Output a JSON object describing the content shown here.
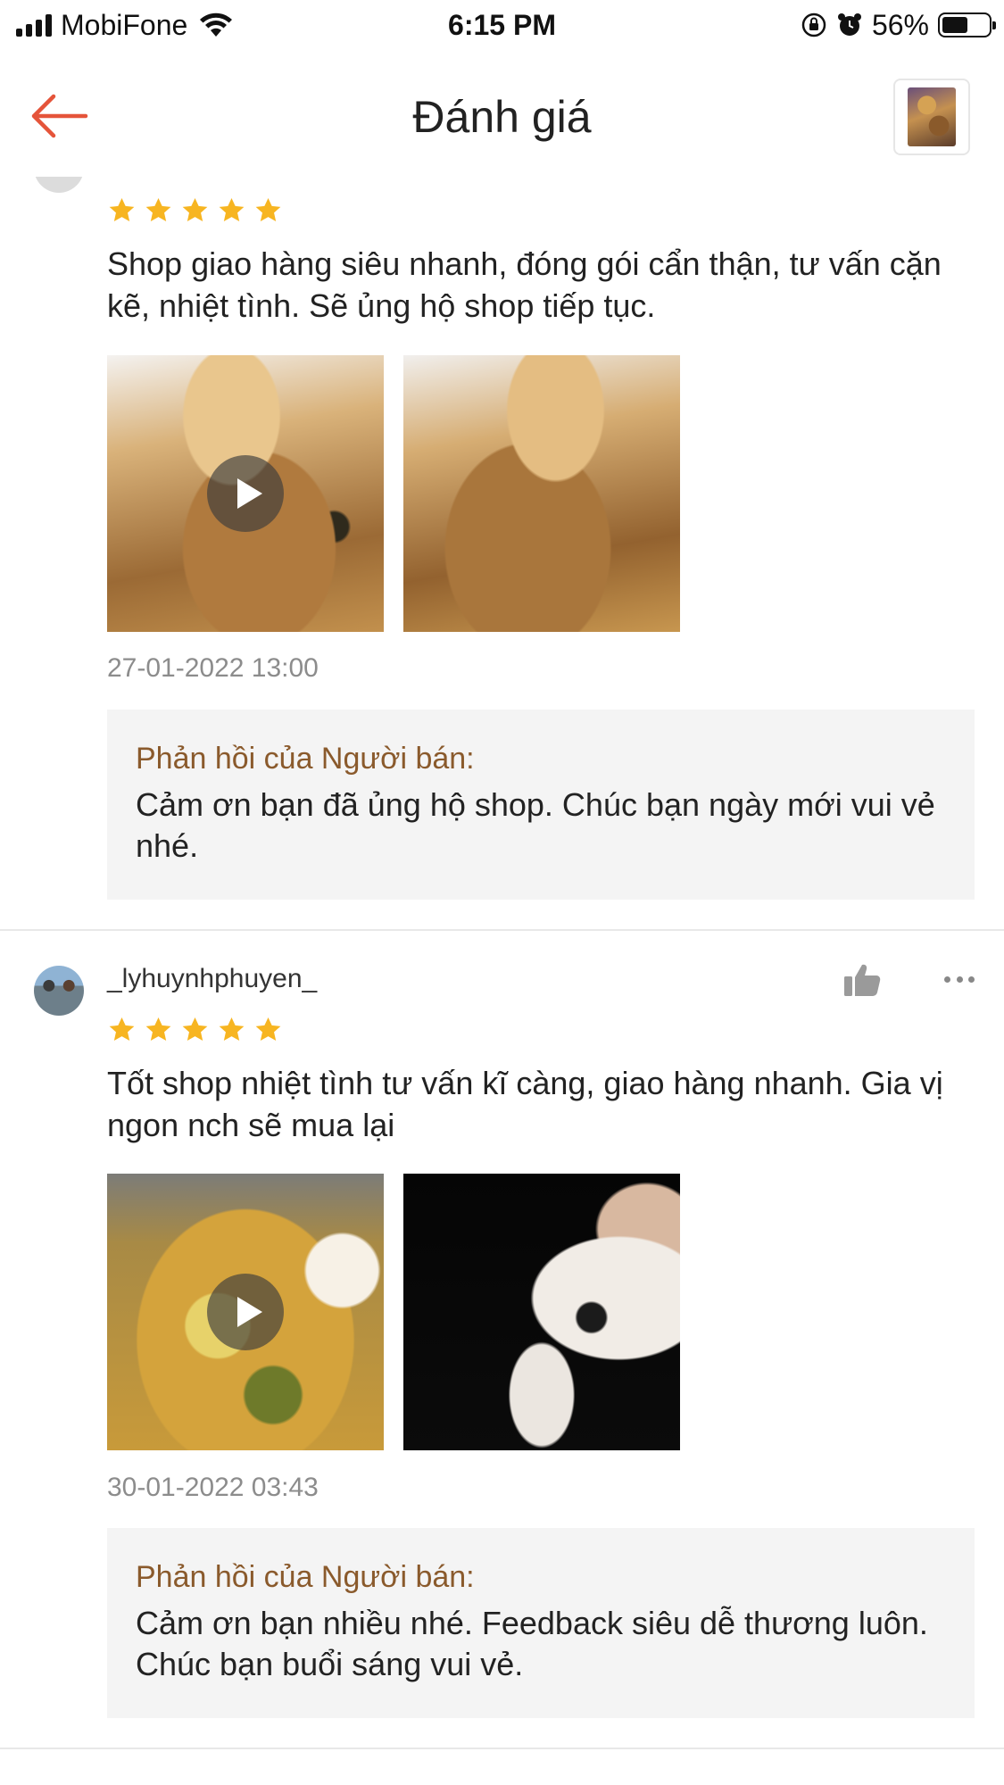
{
  "status_bar": {
    "carrier": "MobiFone",
    "time": "6:15 PM",
    "battery_percent": "56%",
    "battery_level": 0.56,
    "icons": [
      "signal-icon",
      "wifi-icon",
      "orientation-lock-icon",
      "alarm-icon",
      "battery-icon"
    ]
  },
  "header": {
    "title": "Đánh giá",
    "back_icon": "arrow-left-icon",
    "accent_color": "#e5543a"
  },
  "reviews": [
    {
      "username": "",
      "rating": 5,
      "text": "Shop giao hàng siêu nhanh, đóng gói cẩn thận, tư vấn cặn kẽ, nhiệt tình. Sẽ ủng hộ shop tiếp tục.",
      "media": [
        {
          "type": "video",
          "icon": "play-icon"
        },
        {
          "type": "image"
        }
      ],
      "timestamp": "27-01-2022 13:00",
      "seller_reply": {
        "label": "Phản hồi của Người bán:",
        "text": "Cảm ơn bạn đã ủng hộ shop. Chúc bạn ngày mới vui vẻ nhé."
      }
    },
    {
      "username": "_lyhuynhphuyen_",
      "rating": 5,
      "text": "Tốt shop nhiệt tình tư vấn kĩ càng, giao hàng nhanh. Gia vị ngon nch sẽ mua lại",
      "media": [
        {
          "type": "video",
          "icon": "play-icon"
        },
        {
          "type": "image"
        }
      ],
      "timestamp": "30-01-2022 03:43",
      "seller_reply": {
        "label": "Phản hồi của Người bán:",
        "text": "Cảm ơn bạn nhiều nhé. Feedback siêu dễ thương luôn. Chúc bạn buổi sáng vui vẻ."
      }
    }
  ],
  "colors": {
    "star": "#f7b521",
    "reply_label": "#8a5a2c",
    "reply_bg": "#f4f4f4",
    "timestamp": "#8c8c8c"
  }
}
